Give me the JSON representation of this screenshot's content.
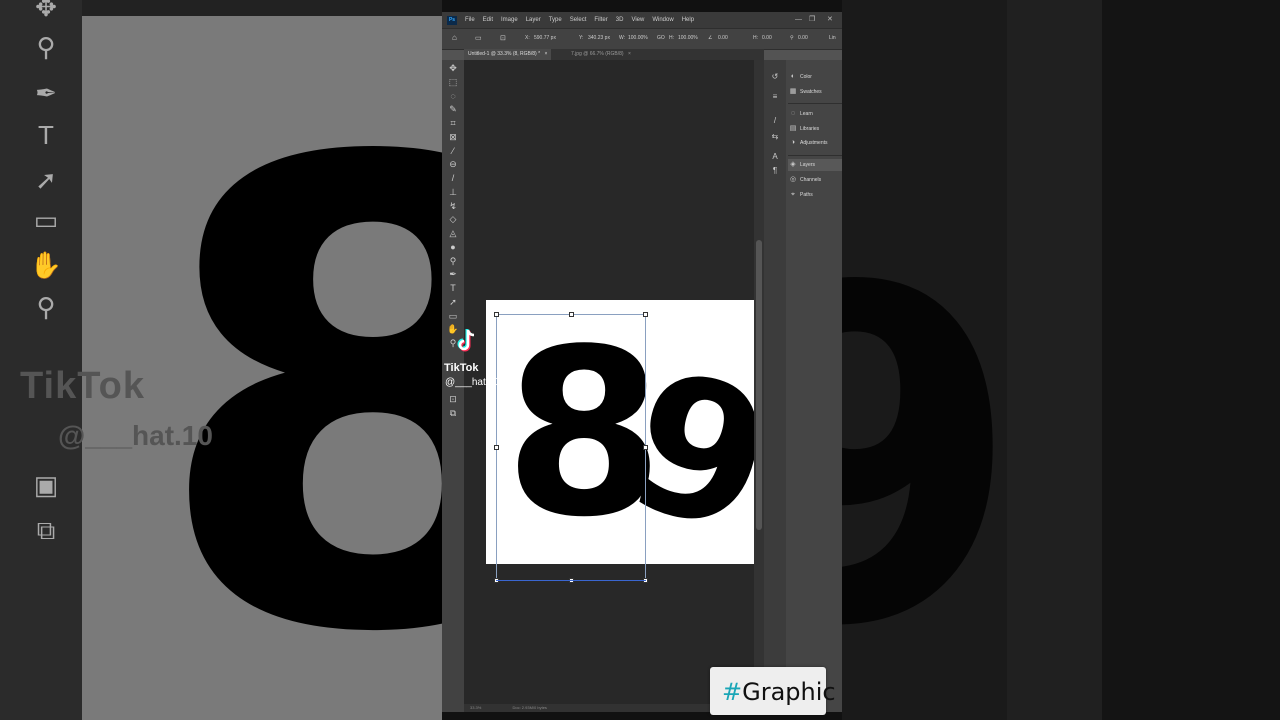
{
  "app": {
    "name": "Photoshop",
    "logo": "Ps"
  },
  "menubar": {
    "items": [
      "File",
      "Edit",
      "Image",
      "Layer",
      "Type",
      "Select",
      "Filter",
      "3D",
      "View",
      "Window",
      "Help"
    ]
  },
  "options": {
    "x_label": "X:",
    "x_value": "590.77 px",
    "y_label": "Y:",
    "y_value": "340.23 px",
    "w_label": "W:",
    "w_value": "100.00%",
    "link_label": "GO",
    "h_label": "H:",
    "h_value": "100.00%",
    "angle_value": "0.00",
    "hskew_label": "H:",
    "hskew_value": "0.00",
    "vskew_value": "0.00",
    "interp_label": "Lin"
  },
  "tabs": [
    {
      "label": "Untitled-1 @ 33.3% (8, RGB/8) *",
      "close": "×"
    },
    {
      "label": "7.jpg @ 66.7% (RGB/8)",
      "close": "×"
    }
  ],
  "panels": {
    "items": [
      {
        "icon": "color-wheel-icon",
        "glyph": "◐",
        "label": "Color"
      },
      {
        "icon": "swatches-icon",
        "glyph": "▦",
        "label": "Swatches"
      },
      {
        "icon": "learn-icon",
        "glyph": "◌",
        "label": "Learn"
      },
      {
        "icon": "libraries-icon",
        "glyph": "▤",
        "label": "Libraries"
      },
      {
        "icon": "adjustments-icon",
        "glyph": "◑",
        "label": "Adjustments"
      },
      {
        "icon": "layers-icon",
        "glyph": "◈",
        "label": "Layers"
      },
      {
        "icon": "channels-icon",
        "glyph": "◎",
        "label": "Channels"
      },
      {
        "icon": "paths-icon",
        "glyph": "⌖",
        "label": "Paths"
      }
    ]
  },
  "canvas": {
    "digits": [
      "8",
      "9"
    ]
  },
  "status": {
    "zoom": "33.3%",
    "doc": "Doc: 2.93M/0 bytes"
  },
  "overlay": {
    "brand": "TikTok",
    "handle": "@___hat.10",
    "hashtag_symbol": "#",
    "hashtag_word": "Graphic"
  },
  "colors": {
    "ps_blue": "#31a8ff",
    "tiktok_cyan": "#25f4ee",
    "tiktok_red": "#fe2c55",
    "hashtag_teal": "#1aa6b7"
  }
}
